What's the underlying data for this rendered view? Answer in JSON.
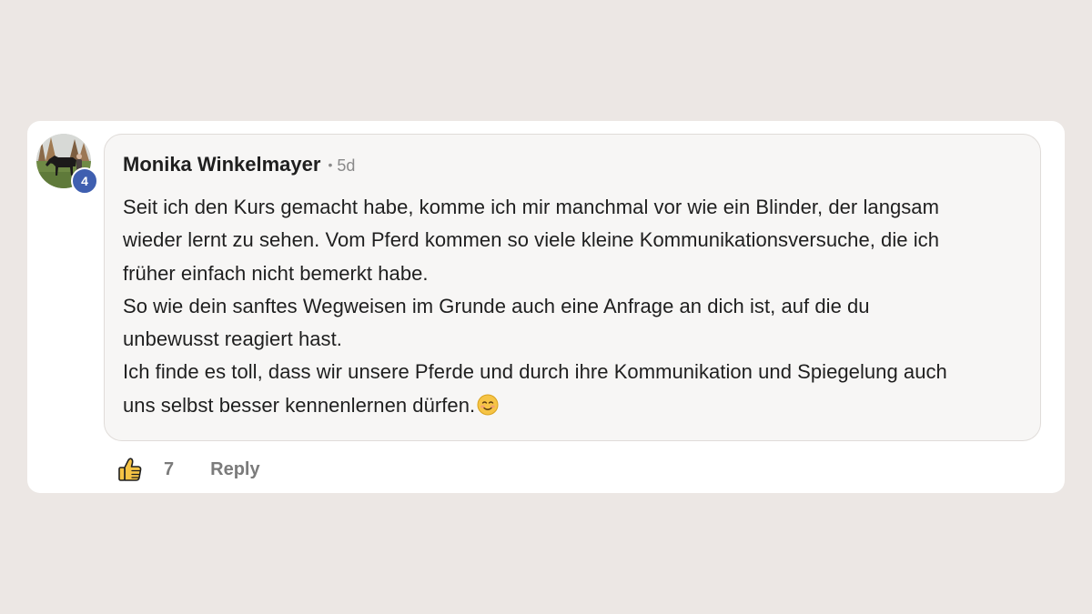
{
  "comment": {
    "author": "Monika Winkelmayer",
    "separator": "•",
    "age": "5d",
    "level_badge": "4",
    "lines": [
      "Seit ich den Kurs gemacht habe, komme ich mir manchmal vor wie ein Blinder, der langsam",
      "wieder lernt zu sehen. Vom Pferd kommen so viele kleine Kommunikationsversuche, die ich",
      "früher einfach nicht bemerkt habe.",
      "So wie dein sanftes Wegweisen im Grunde auch eine Anfrage an dich ist, auf die du",
      "unbewusst reagiert hast.",
      "Ich finde es toll, dass wir unsere Pferde und durch ihre Kommunikation und Spiegelung auch",
      "uns selbst besser kennenlernen dürfen."
    ],
    "emoji": "smiling-face-emoji"
  },
  "actions": {
    "like_icon": "thumbs-up-icon",
    "like_count": "7",
    "reply_label": "Reply"
  },
  "colors": {
    "page_background": "#ece7e4",
    "card_background": "#ffffff",
    "bubble_background": "#f7f6f5",
    "badge": "#3f5fb0",
    "muted_text": "#7b7b7b"
  }
}
